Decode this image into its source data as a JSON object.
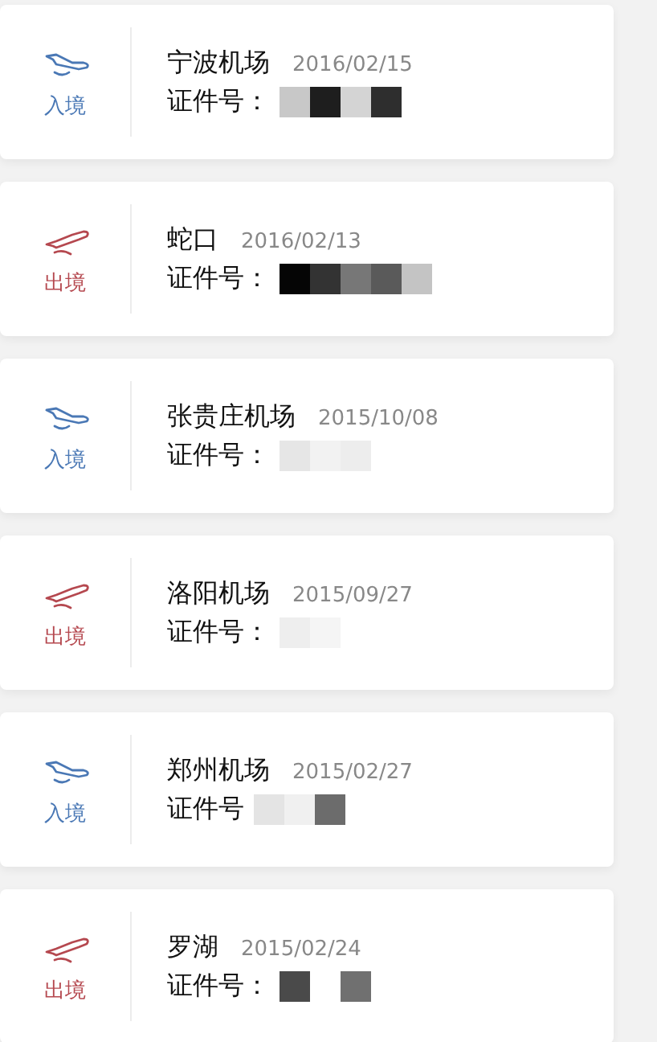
{
  "records": [
    {
      "kind": "entry",
      "direction": "入境",
      "place": "宁波机场",
      "date": "2016/02/15",
      "id_label": "证件号："
    },
    {
      "kind": "exit",
      "direction": "出境",
      "place": "蛇口",
      "date": "2016/02/13",
      "id_label": "证件号："
    },
    {
      "kind": "entry",
      "direction": "入境",
      "place": "张贵庄机场",
      "date": "2015/10/08",
      "id_label": "证件号："
    },
    {
      "kind": "exit",
      "direction": "出境",
      "place": "洛阳机场",
      "date": "2015/09/27",
      "id_label": "证件号："
    },
    {
      "kind": "entry",
      "direction": "入境",
      "place": "郑州机场",
      "date": "2015/02/27",
      "id_label": "证件号"
    },
    {
      "kind": "exit",
      "direction": "出境",
      "place": "罗湖",
      "date": "2015/02/24",
      "id_label": "证件号："
    }
  ]
}
